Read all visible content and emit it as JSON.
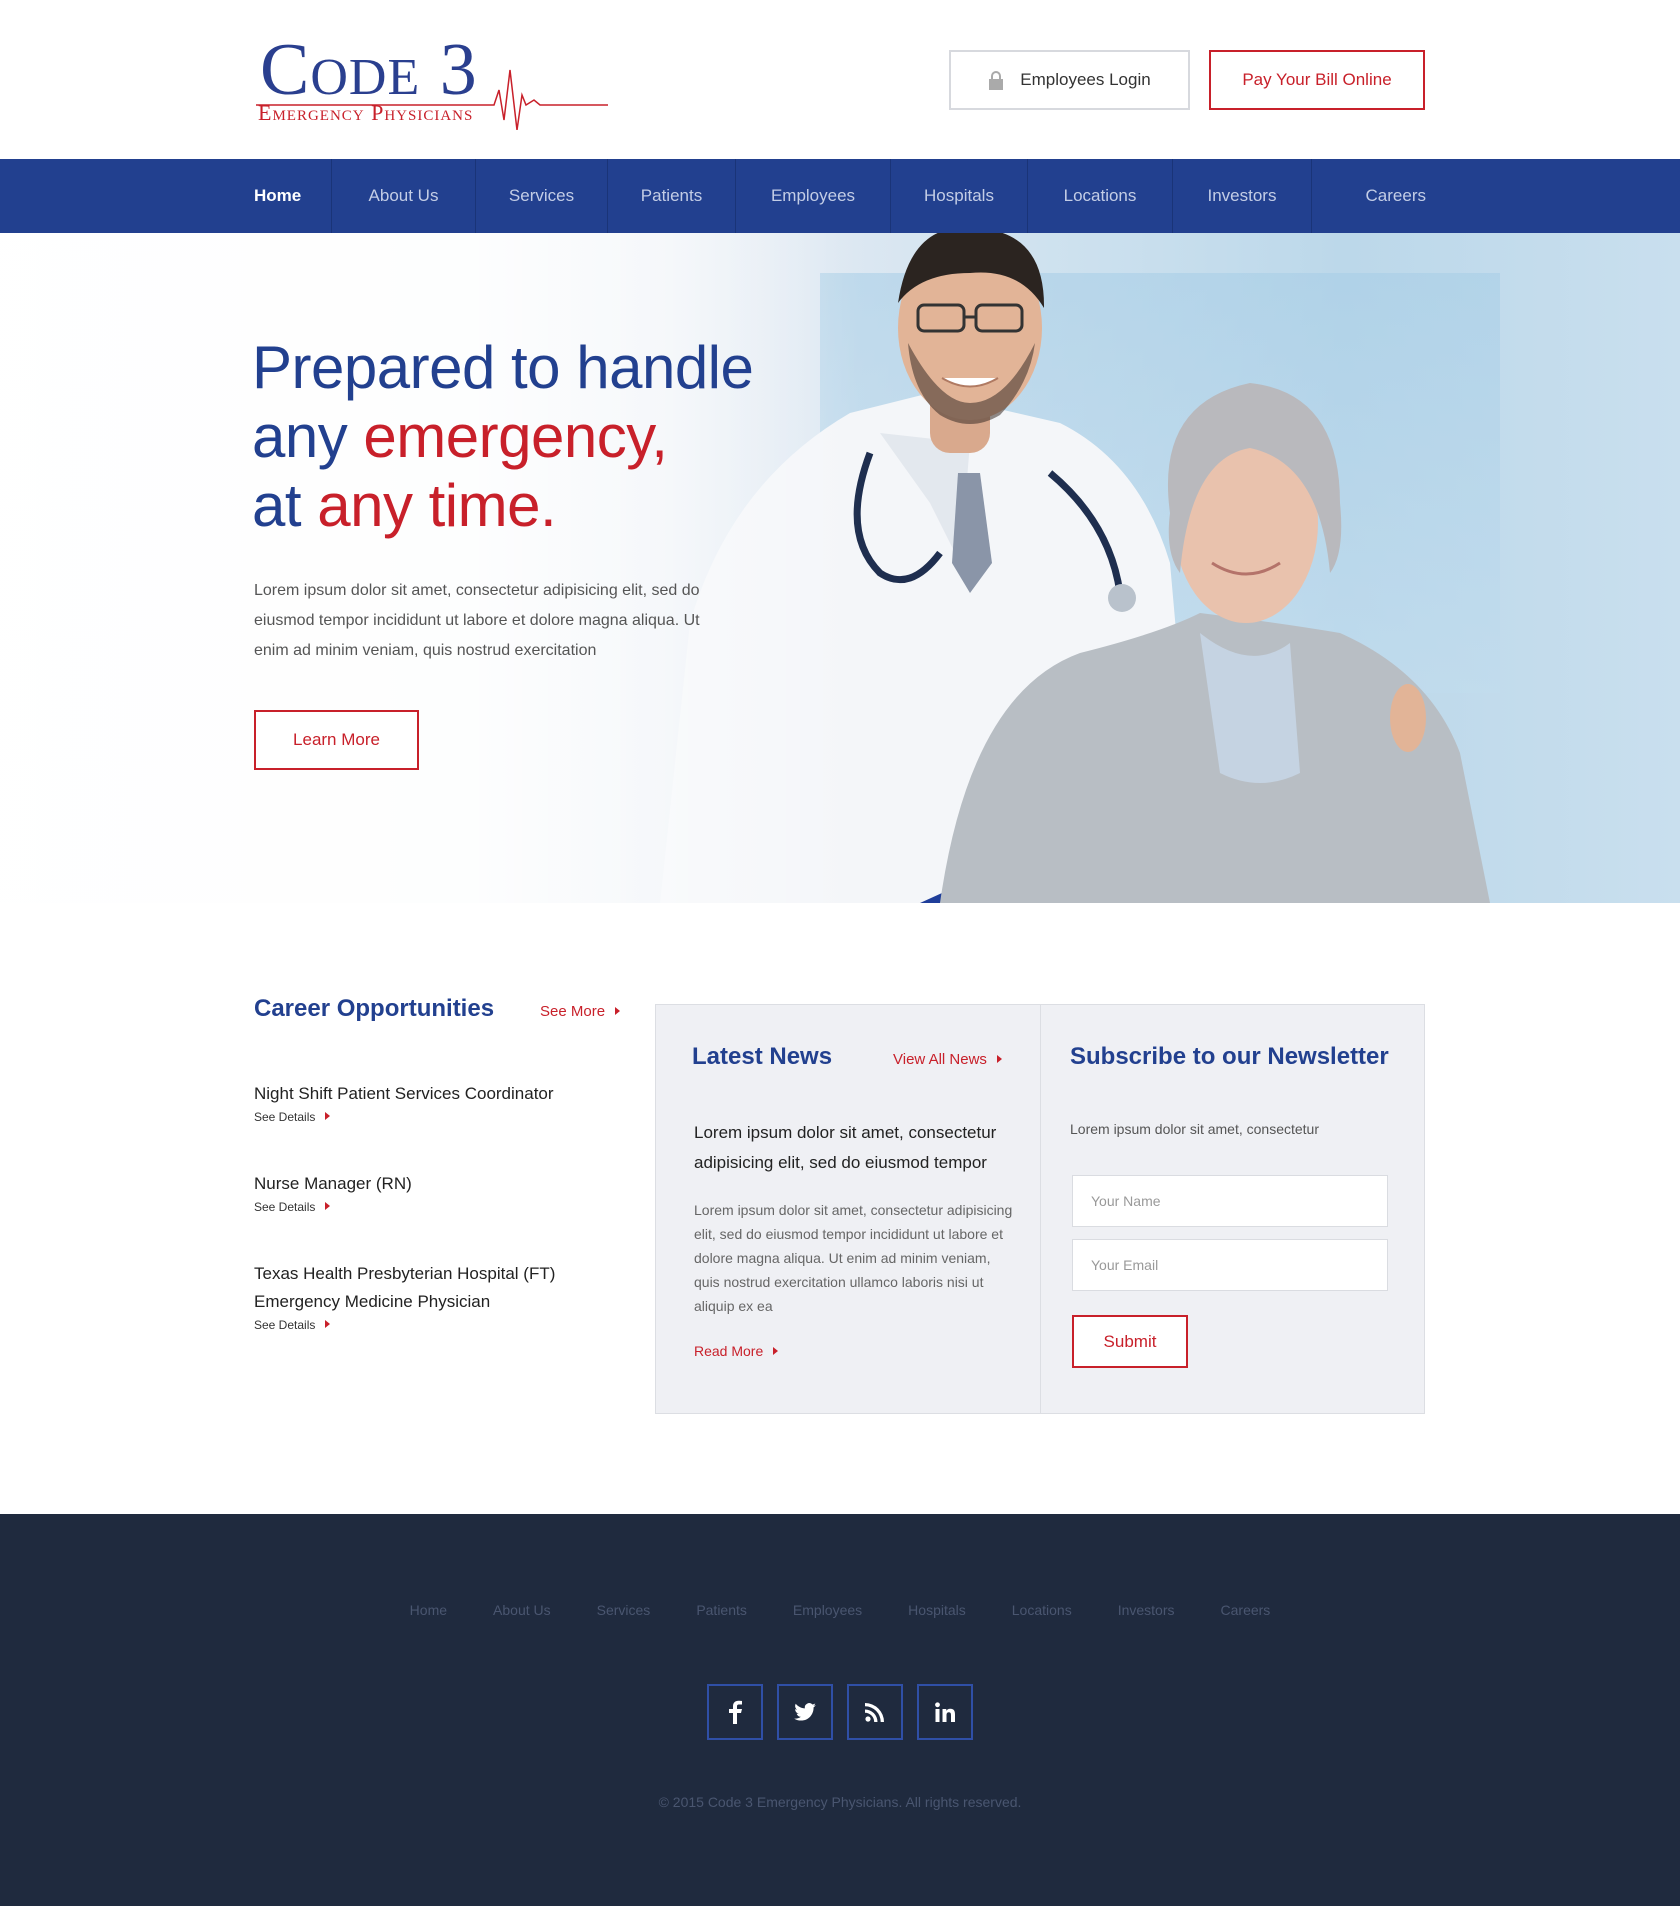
{
  "header": {
    "logo_main": "Code 3",
    "logo_sub": "Emergency Physicians",
    "login_label": "Employees Login",
    "pay_label": "Pay Your Bill Online"
  },
  "nav": {
    "items": [
      "Home",
      "About Us",
      "Services",
      "Patients",
      "Employees",
      "Hospitals",
      "Locations",
      "Investors",
      "Careers"
    ],
    "active": "Home"
  },
  "hero": {
    "title_line1": "Prepared to handle",
    "title_line2_a": "any ",
    "title_line2_b": "emergency,",
    "title_line3_a": "at ",
    "title_line3_b": "any time.",
    "text": "Lorem ipsum dolor sit amet, consectetur adipisicing elit, sed do eiusmod tempor incididunt ut labore et dolore magna aliqua. Ut enim ad minim veniam, quis nostrud exercitation",
    "cta": "Learn More"
  },
  "careers": {
    "title": "Career Opportunities",
    "see_more": "See More",
    "jobs": [
      {
        "title": "Night Shift Patient Services Coordinator",
        "link": "See Details"
      },
      {
        "title": "Nurse Manager (RN)",
        "link": "See Details"
      },
      {
        "title": "Texas Health Presbyterian Hospital (FT) Emergency Medicine Physician",
        "link": "See Details"
      }
    ]
  },
  "news": {
    "title": "Latest News",
    "view_all": "View All News",
    "lead": "Lorem ipsum dolor sit amet, consectetur adipisicing elit, sed do eiusmod tempor",
    "body": "Lorem ipsum dolor sit amet, consectetur adipisicing elit, sed do eiusmod tempor incididunt ut labore et dolore magna aliqua. Ut enim ad minim veniam, quis nostrud exercitation ullamco laboris nisi ut aliquip ex ea",
    "read_more": "Read More"
  },
  "newsletter": {
    "title": "Subscribe to our Newsletter",
    "text": "Lorem ipsum dolor sit amet, consectetur",
    "name_placeholder": "Your Name",
    "email_placeholder": "Your Email",
    "submit": "Submit"
  },
  "footer": {
    "nav": [
      "Home",
      "About Us",
      "Services",
      "Patients",
      "Employees",
      "Hospitals",
      "Locations",
      "Investors",
      "Careers"
    ],
    "socials": [
      "facebook-icon",
      "twitter-icon",
      "rss-icon",
      "linkedin-icon"
    ],
    "copyright": "© 2015 Code 3 Emergency Physicians. All rights reserved."
  },
  "colors": {
    "brand_blue": "#22408f",
    "accent_red": "#c8202a",
    "footer_bg": "#1f2a3e"
  }
}
